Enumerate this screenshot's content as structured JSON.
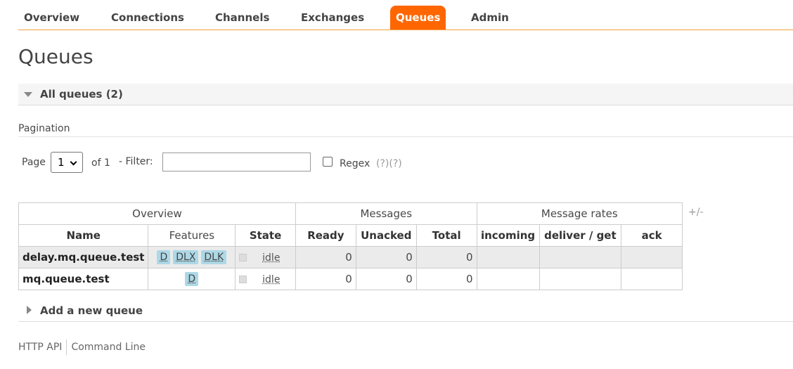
{
  "nav": {
    "items": [
      "Overview",
      "Connections",
      "Channels",
      "Exchanges",
      "Queues",
      "Admin"
    ],
    "active": "Queues"
  },
  "page_title": "Queues",
  "all_queues": {
    "label": "All queues (2)"
  },
  "pagination": {
    "label": "Pagination",
    "page_label": "Page",
    "page_value": "1",
    "of_label": "of 1",
    "filter_label": "- Filter:",
    "filter_value": "",
    "regex_label": "Regex",
    "regex_help": "(?)(?)",
    "regex_checked": false
  },
  "table": {
    "groups": [
      "Overview",
      "Messages",
      "Message rates"
    ],
    "columns": [
      "Name",
      "Features",
      "State",
      "Ready",
      "Unacked",
      "Total",
      "incoming",
      "deliver / get",
      "ack"
    ],
    "rows": [
      {
        "name": "delay.mq.queue.test",
        "features": [
          "D",
          "DLX",
          "DLK"
        ],
        "state": "idle",
        "ready": "0",
        "unacked": "0",
        "total": "0",
        "incoming": "",
        "deliver_get": "",
        "ack": ""
      },
      {
        "name": "mq.queue.test",
        "features": [
          "D"
        ],
        "state": "idle",
        "ready": "0",
        "unacked": "0",
        "total": "0",
        "incoming": "",
        "deliver_get": "",
        "ack": ""
      }
    ],
    "columns_toggle": "+/-"
  },
  "add_queue": {
    "label": "Add a new queue"
  },
  "footer": {
    "links": [
      "HTTP API",
      "Command Line"
    ]
  },
  "colors": {
    "accent": "#ff6600",
    "tag_bg": "#add8e6",
    "row_alt_bg": "#ebebeb"
  }
}
